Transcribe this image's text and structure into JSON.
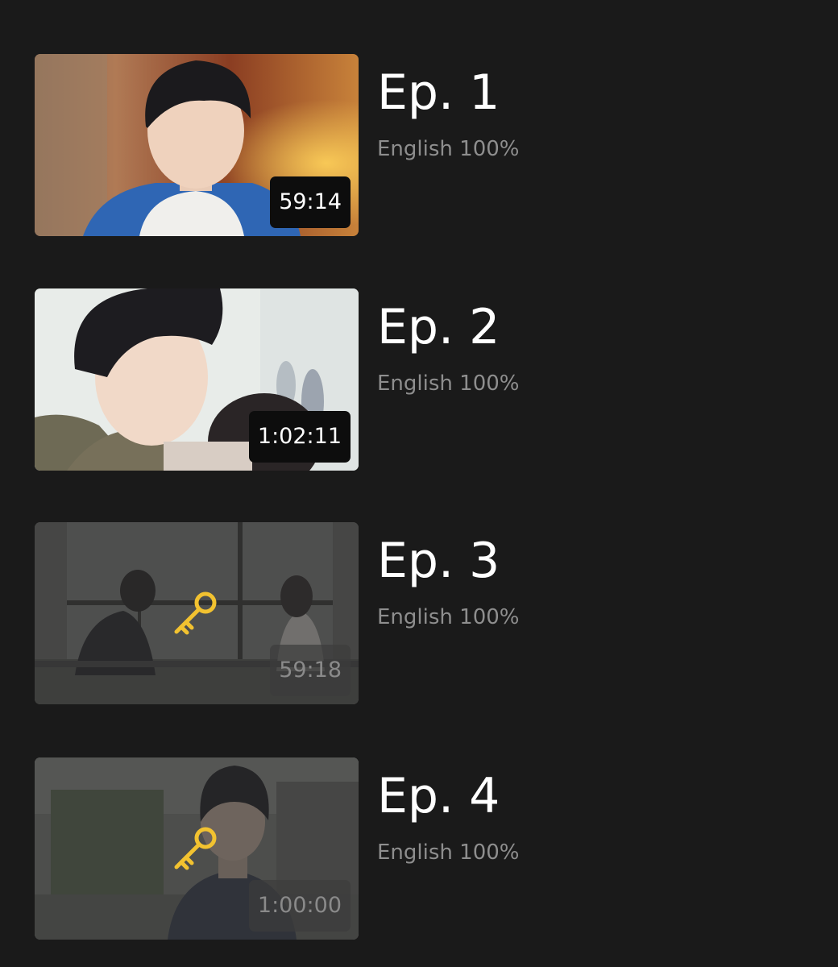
{
  "episodes": [
    {
      "title": "Ep. 1",
      "language": "English 100%",
      "duration": "59:14",
      "locked": false
    },
    {
      "title": "Ep. 2",
      "language": "English 100%",
      "duration": "1:02:11",
      "locked": false
    },
    {
      "title": "Ep. 3",
      "language": "English 100%",
      "duration": "59:18",
      "locked": true
    },
    {
      "title": "Ep. 4",
      "language": "English 100%",
      "duration": "1:00:00",
      "locked": true
    }
  ],
  "colors": {
    "background": "#1a1a1a",
    "title": "#ffffff",
    "subtitle": "#8e8e8e",
    "lock_key": "#f2c230"
  },
  "icons": {
    "lock": "key-icon"
  }
}
